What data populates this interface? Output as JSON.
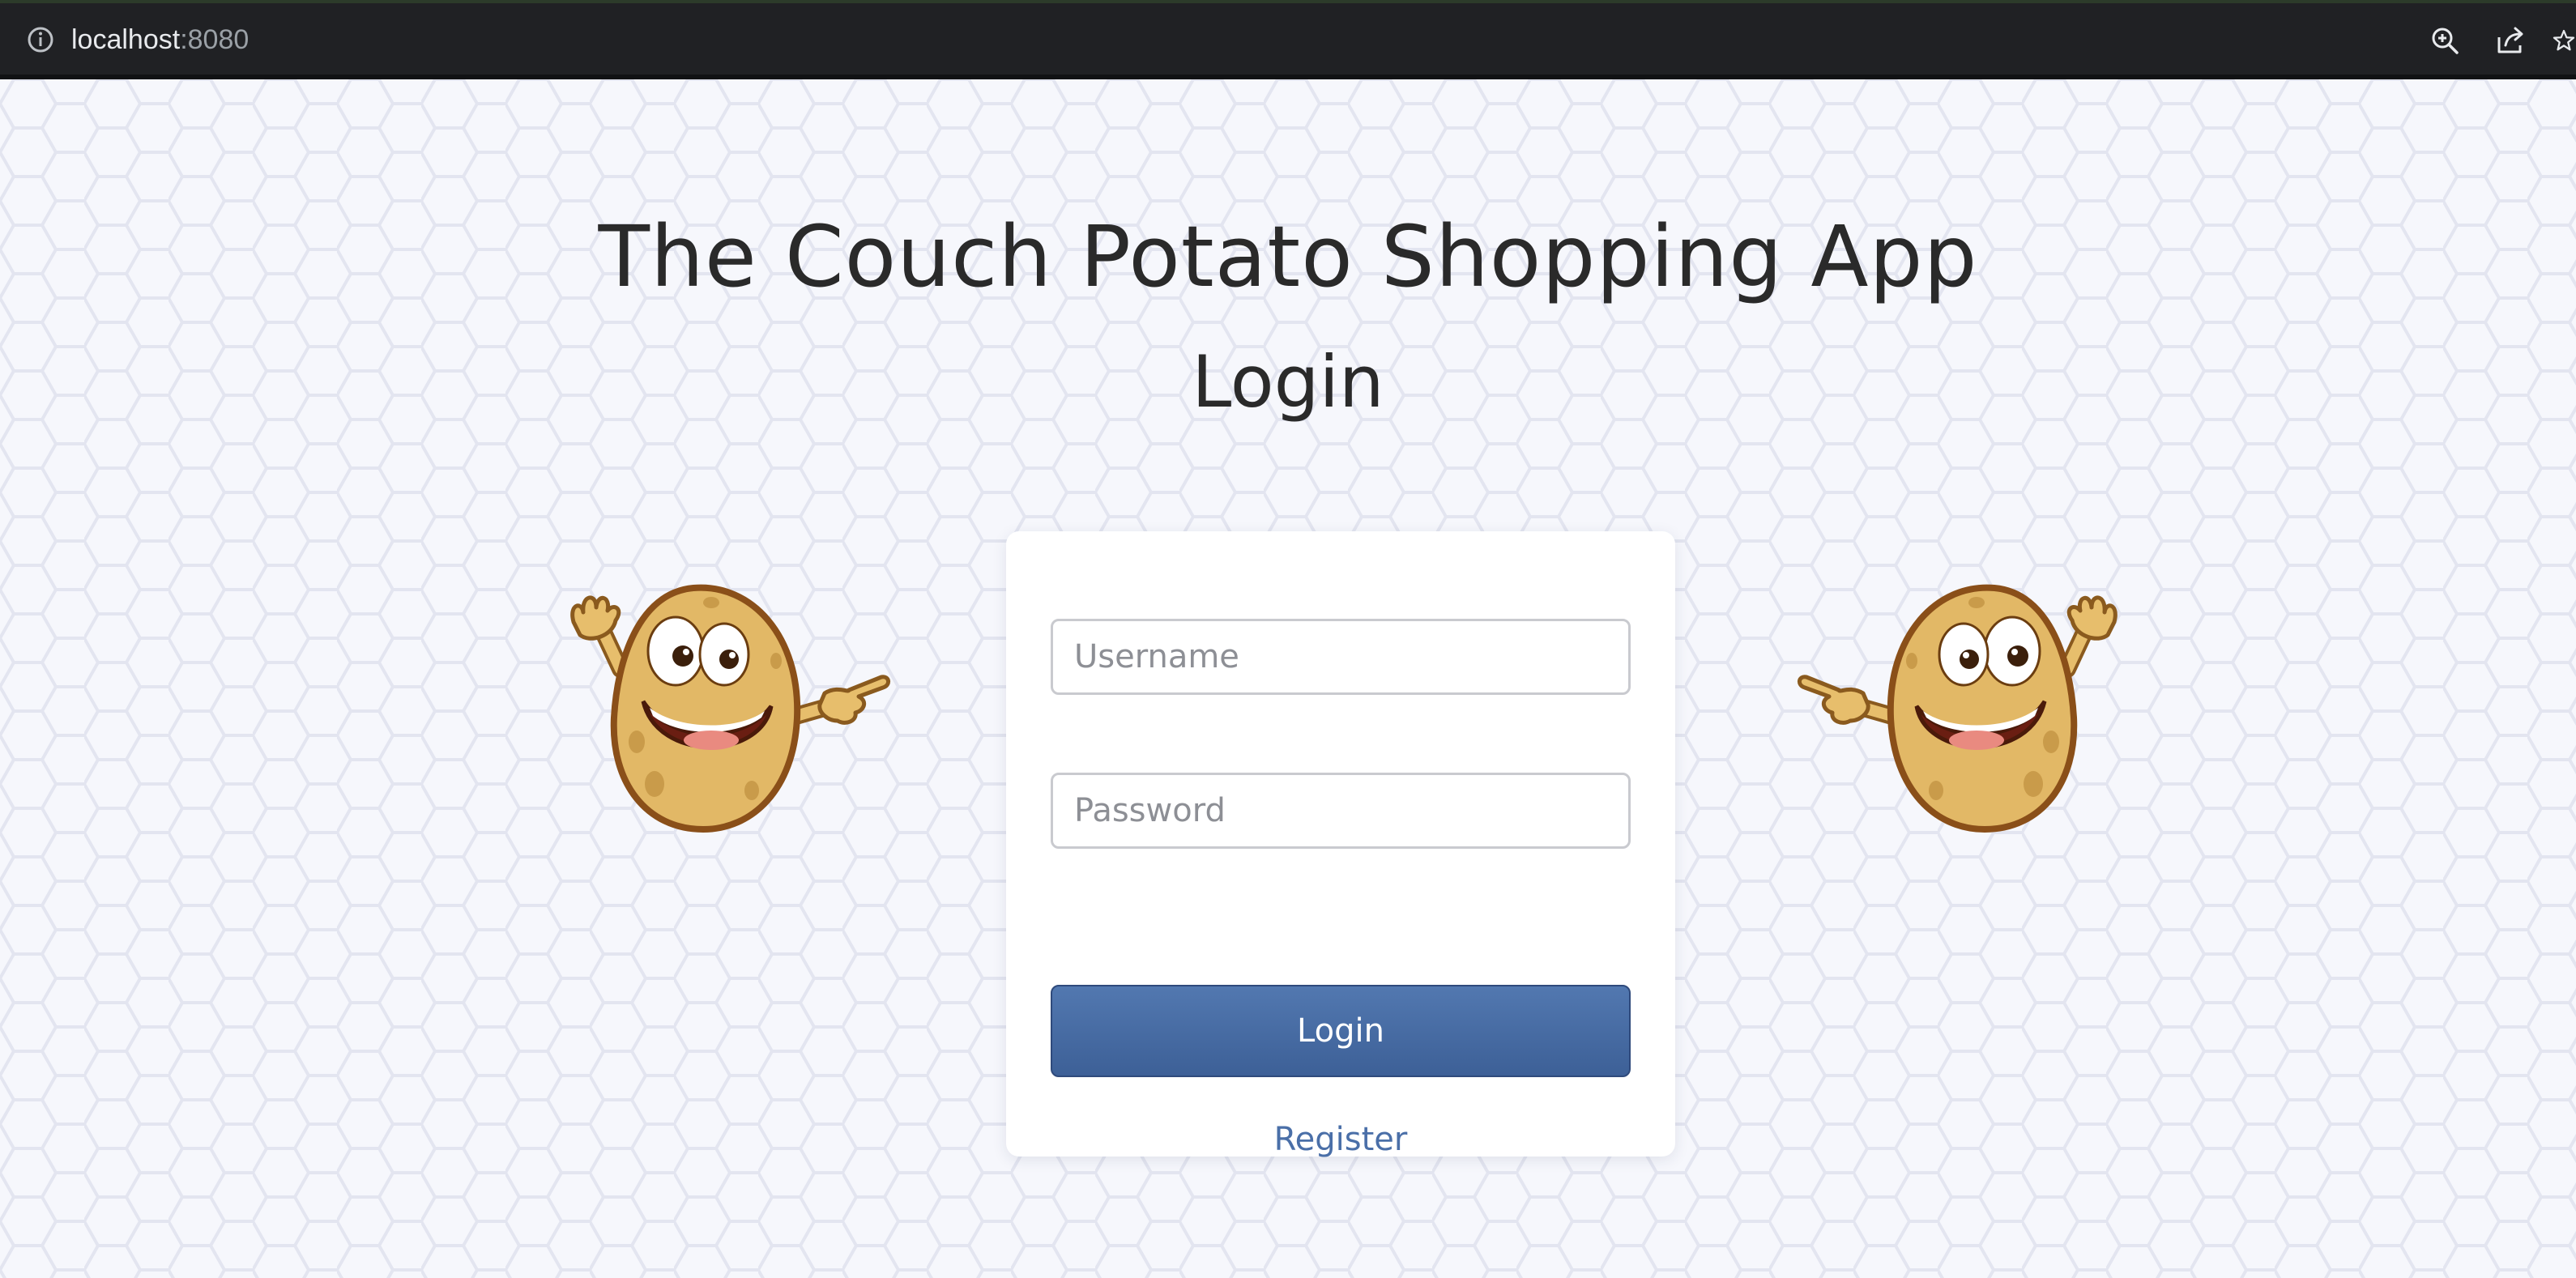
{
  "browser": {
    "url_host": "localhost",
    "url_port": ":8080",
    "icons": [
      "info-icon",
      "zoom-icon",
      "share-icon",
      "star-icon"
    ]
  },
  "page": {
    "app_title": "The Couch Potato Shopping App",
    "heading": "Login"
  },
  "form": {
    "username_placeholder": "Username",
    "password_placeholder": "Password",
    "login_label": "Login",
    "register_label": "Register"
  },
  "colors": {
    "primary_button": "#4a6ea5",
    "link": "#4a6fa8",
    "title_text": "#2a2a2a",
    "potato_body": "#e2b866"
  }
}
